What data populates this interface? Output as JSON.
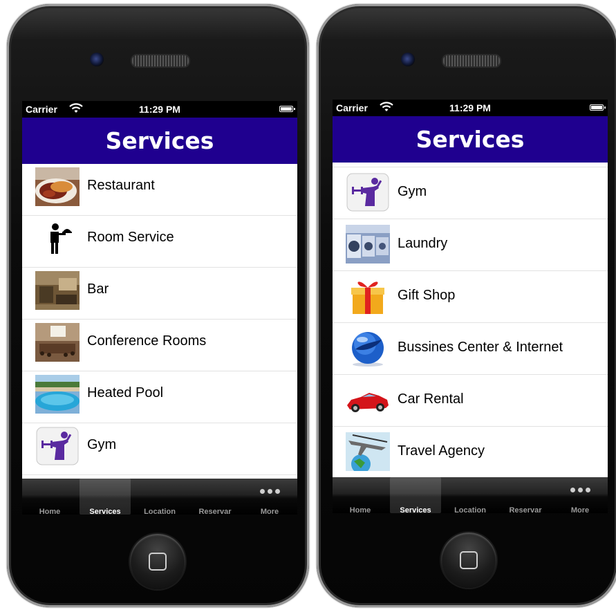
{
  "colors": {
    "nav_background": "#1f008f",
    "tabbar_background": "#000000",
    "list_background": "#ffffff"
  },
  "phones": [
    {
      "status": {
        "carrier": "Carrier",
        "time": "11:29 PM"
      },
      "title": "Services",
      "items": [
        {
          "label": "Restaurant",
          "icon": "restaurant-photo"
        },
        {
          "label": "Room Service",
          "icon": "waiter-icon"
        },
        {
          "label": "Bar",
          "icon": "bar-photo"
        },
        {
          "label": "Conference Rooms",
          "icon": "conference-room-photo"
        },
        {
          "label": "Heated Pool",
          "icon": "pool-photo"
        },
        {
          "label": "Gym",
          "icon": "gym-icon"
        }
      ],
      "tabs": [
        "Home",
        "Services",
        "Location",
        "Reservar",
        "More"
      ],
      "active_tab": "Services"
    },
    {
      "status": {
        "carrier": "Carrier",
        "time": "11:29 PM"
      },
      "title": "Services",
      "items": [
        {
          "label": "Gym",
          "icon": "gym-icon"
        },
        {
          "label": "Laundry",
          "icon": "laundry-photo"
        },
        {
          "label": "Gift Shop",
          "icon": "gift-icon"
        },
        {
          "label": "Bussines Center & Internet",
          "icon": "globe-icon"
        },
        {
          "label": "Car Rental",
          "icon": "car-icon"
        },
        {
          "label": "Travel Agency",
          "icon": "airplane-globe-icon"
        }
      ],
      "tabs": [
        "Home",
        "Services",
        "Location",
        "Reservar",
        "More"
      ],
      "active_tab": "Services"
    }
  ]
}
